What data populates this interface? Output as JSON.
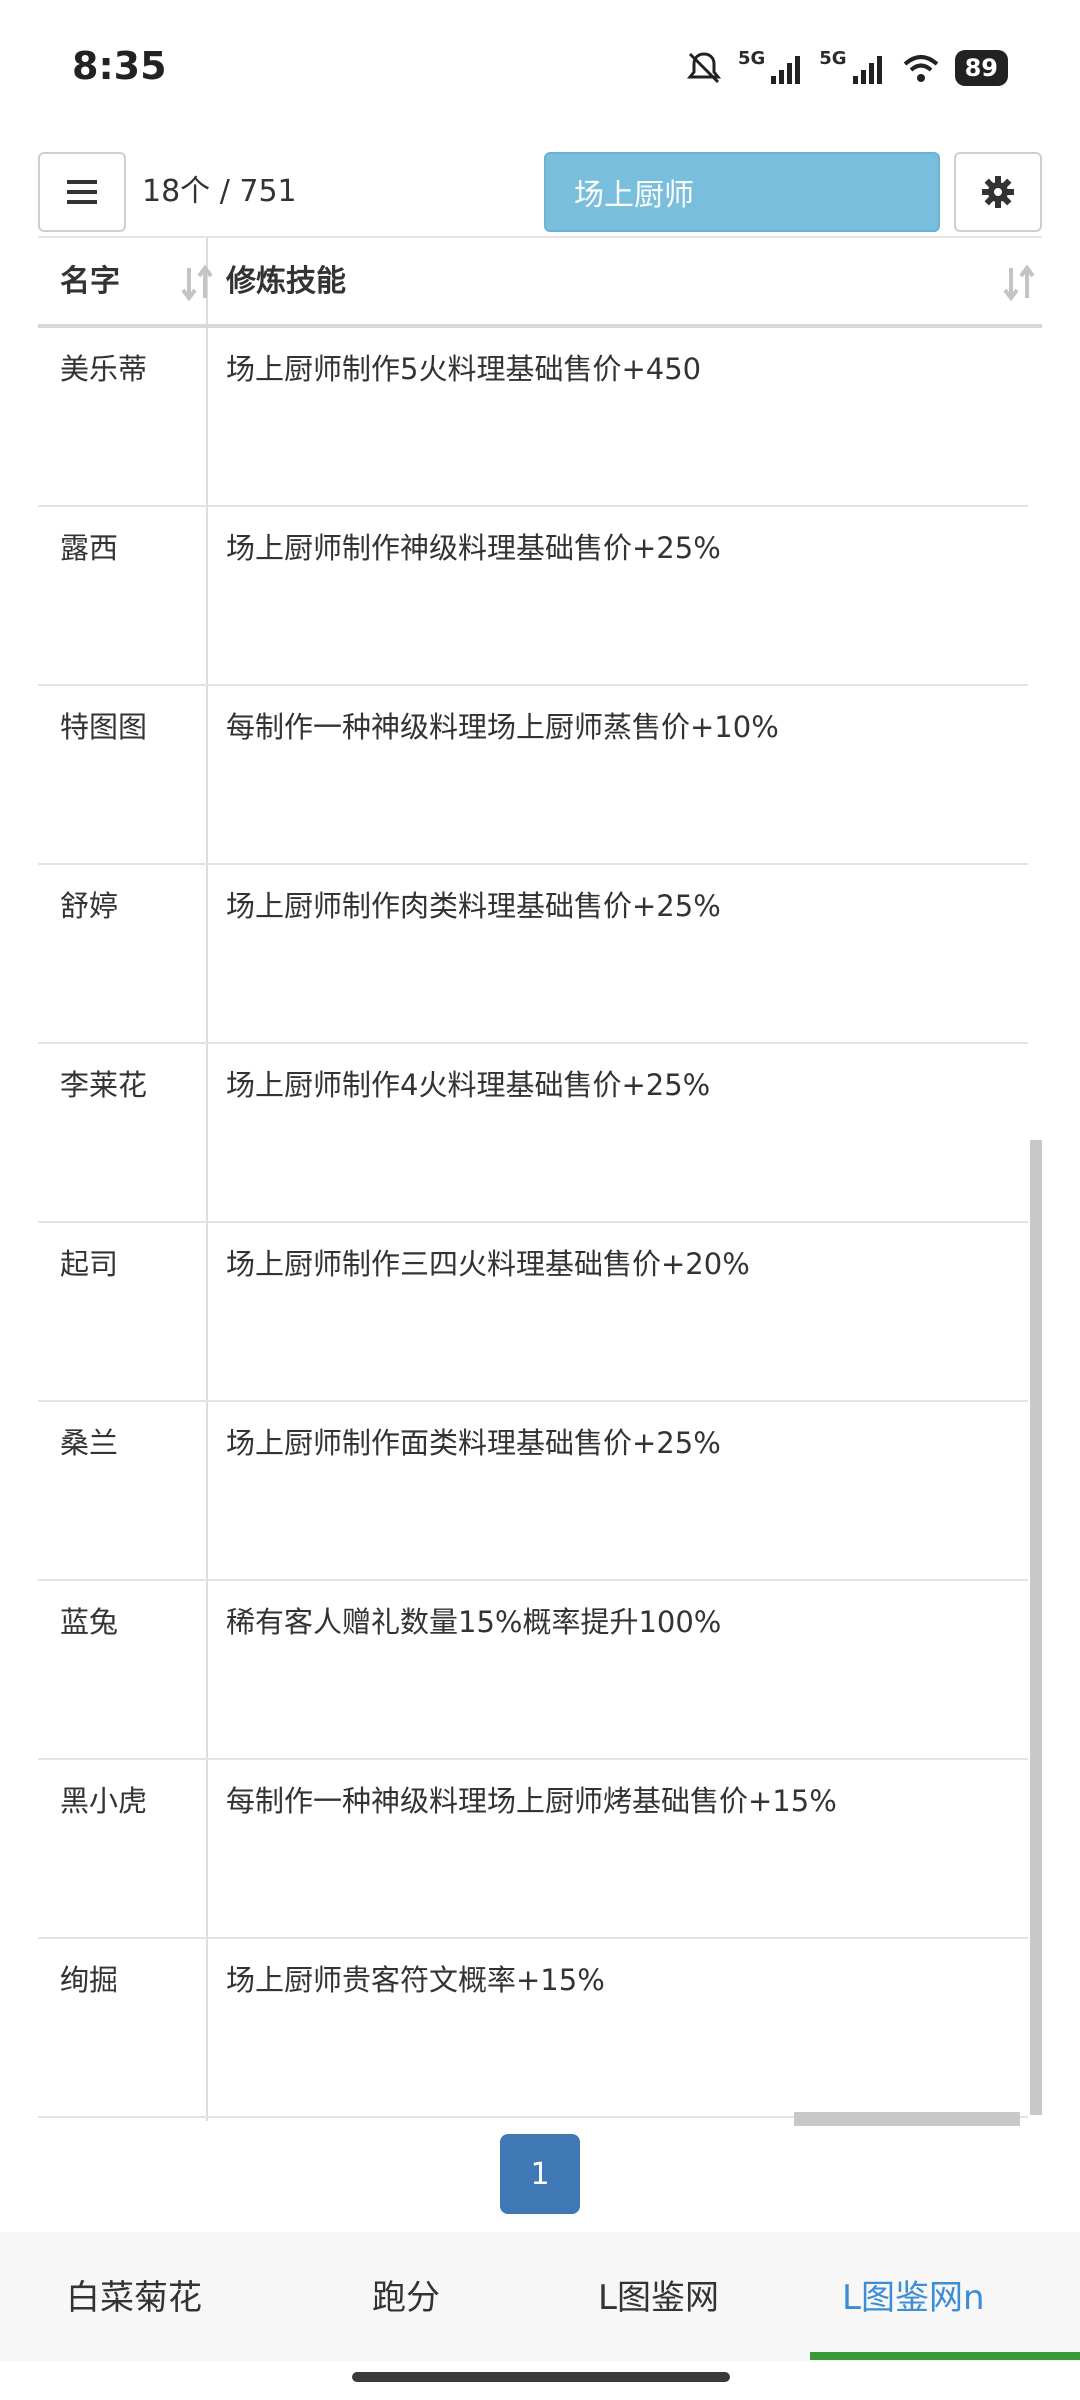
{
  "status_bar": {
    "time": "8:35",
    "network_1": "5G",
    "network_2": "5G",
    "battery": "89",
    "icons": [
      "mute-icon",
      "signal-icon",
      "signal-icon",
      "wifi-icon",
      "battery-icon"
    ]
  },
  "toolbar": {
    "menu_icon": "hamburger-icon",
    "count": "18个 / 751",
    "filter_value": "场上厨师",
    "settings_icon": "gear-icon"
  },
  "table": {
    "headers": [
      "名字",
      "修炼技能"
    ],
    "rows": [
      {
        "name": "美乐蒂",
        "skill": "场上厨师制作5火料理基础售价+450"
      },
      {
        "name": "露西",
        "skill": "场上厨师制作神级料理基础售价+25%"
      },
      {
        "name": "特图图",
        "skill": "每制作一种神级料理场上厨师蒸售价+10%"
      },
      {
        "name": "舒婷",
        "skill": "场上厨师制作肉类料理基础售价+25%"
      },
      {
        "name": "李莱花",
        "skill": "场上厨师制作4火料理基础售价+25%"
      },
      {
        "name": "起司",
        "skill": "场上厨师制作三四火料理基础售价+20%"
      },
      {
        "name": "桑兰",
        "skill": "场上厨师制作面类料理基础售价+25%"
      },
      {
        "name": "蓝兔",
        "skill": "稀有客人赠礼数量15%概率提升100%"
      },
      {
        "name": "黑小虎",
        "skill": "每制作一种神级料理场上厨师烤基础售价+15%"
      },
      {
        "name": "绚掘",
        "skill": "场上厨师贵客符文概率+15%"
      }
    ]
  },
  "pagination": {
    "current": "1"
  },
  "tabs": [
    {
      "label": "白菜菊花",
      "active": false
    },
    {
      "label": "跑分",
      "active": false
    },
    {
      "label": "L图鉴网",
      "active": false
    },
    {
      "label": "L图鉴网n",
      "active": true
    }
  ],
  "colors": {
    "filter_bg": "#79bfdd",
    "page_button": "#3f78b5",
    "active_tab": "#3c8dd6",
    "tab_indicator": "#3a9a3a"
  }
}
